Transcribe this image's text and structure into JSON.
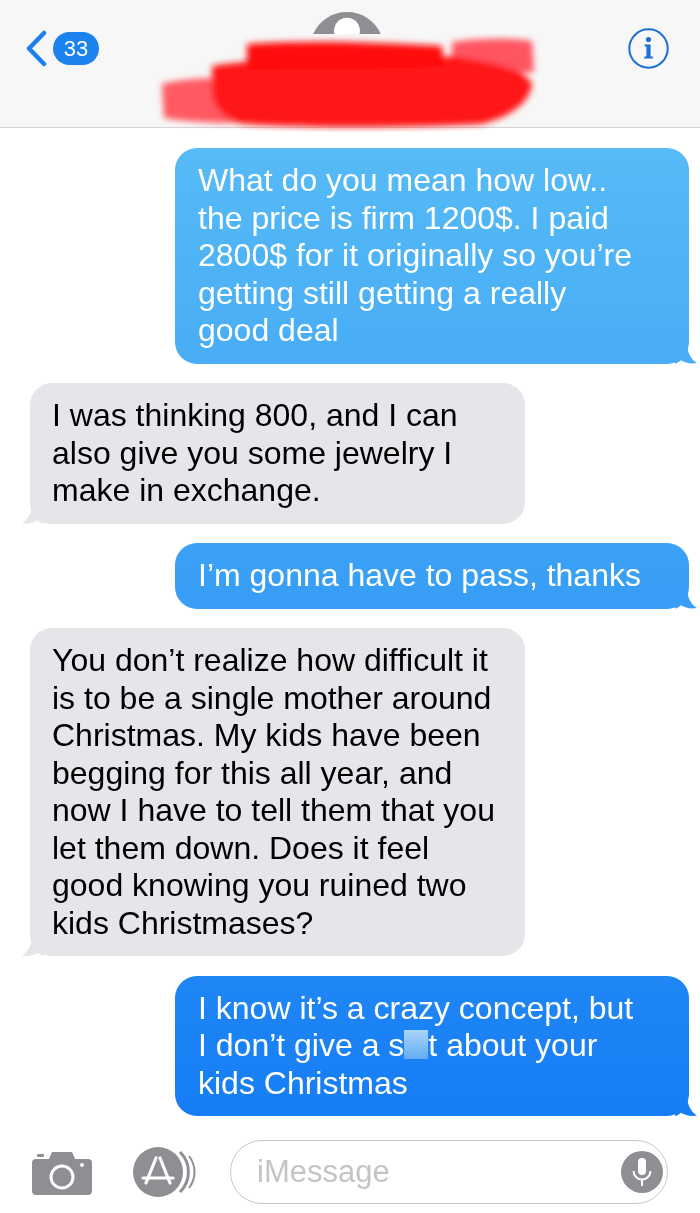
{
  "header": {
    "badge": "33"
  },
  "messages": [
    {
      "kind": "sent",
      "segments": [
        {
          "kind": "text",
          "text": "What do you mean how low.. the price is firm 1200$. I paid 2800$ for it originally so you’re getting still getting a really good deal"
        }
      ]
    },
    {
      "kind": "received",
      "segments": [
        {
          "kind": "text",
          "text": "I was thinking 800, and I can also give you some jewelry I make in exchange."
        }
      ]
    },
    {
      "kind": "sent",
      "segments": [
        {
          "kind": "text",
          "text": "I’m gonna have to pass, thanks"
        }
      ]
    },
    {
      "kind": "received",
      "segments": [
        {
          "kind": "text",
          "text": "You don’t realize how difficult it is to be a single mother around Christmas. My kids have been begging for this all year, and now I have to tell them that you let them down. Does it feel good knowing you ruined two kids Christmases?"
        }
      ]
    },
    {
      "kind": "sent",
      "segments": [
        {
          "kind": "text",
          "text": "I know it’s a crazy concept, but I don’t give a s"
        },
        {
          "kind": "blur"
        },
        {
          "kind": "text",
          "text": "t about your kids Christmas"
        }
      ]
    }
  ],
  "composer": {
    "placeholder": "iMessage"
  }
}
